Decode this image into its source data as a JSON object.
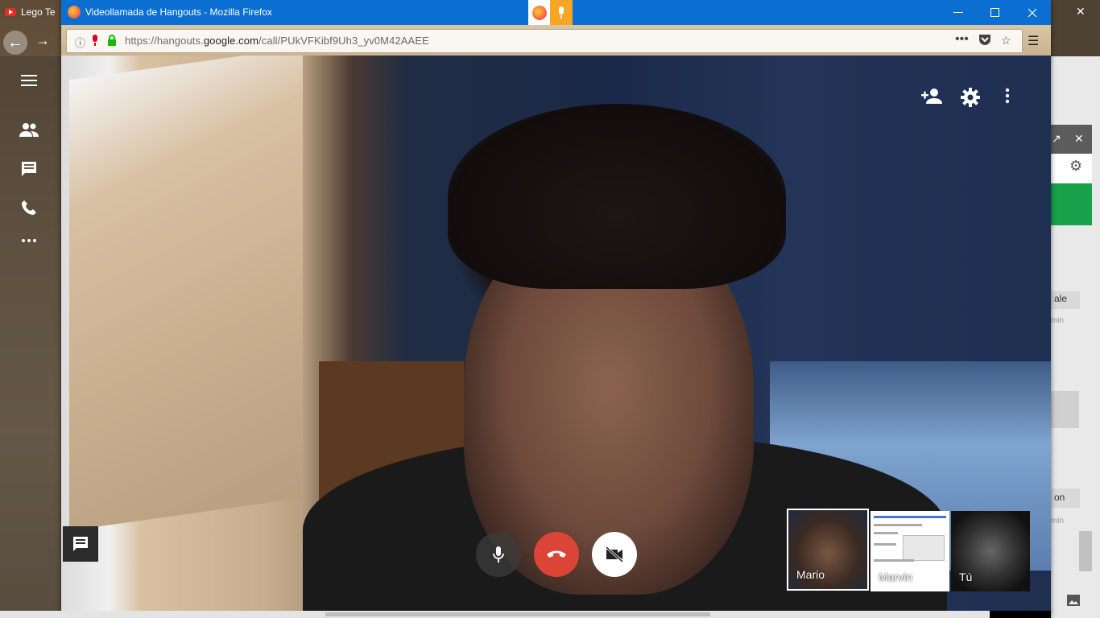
{
  "background": {
    "tab_title": "Lego Te",
    "right_panel": {
      "label_1": "ale",
      "time_1": "min",
      "label_2": "on",
      "time_2": "min"
    }
  },
  "window": {
    "title": "Videollamada de Hangouts - Mozilla Firefox",
    "controls": [
      "minimize",
      "maximize",
      "close"
    ]
  },
  "urlbar": {
    "url_prefix": "https://hangouts.",
    "url_domain": "google.com",
    "url_path": "/call/PUkVFKibf9Uh3_yv0M42AAEE"
  },
  "hangouts": {
    "left_rail_icons": [
      "menu-icon",
      "people-icon",
      "chat-icon",
      "phone-icon",
      "more-icon"
    ],
    "top_actions": [
      "add-person-icon",
      "settings-icon",
      "more-vert-icon"
    ],
    "controls": [
      "microphone",
      "hang-up",
      "camera-off"
    ],
    "participants": [
      {
        "name": "Mario",
        "selected": true
      },
      {
        "name": "Marvin",
        "selected": false
      },
      {
        "name": "Tú",
        "selected": false
      }
    ]
  },
  "colors": {
    "titlebar": "#0a6fd1",
    "hangup": "#db4437",
    "green": "#16a14a"
  }
}
